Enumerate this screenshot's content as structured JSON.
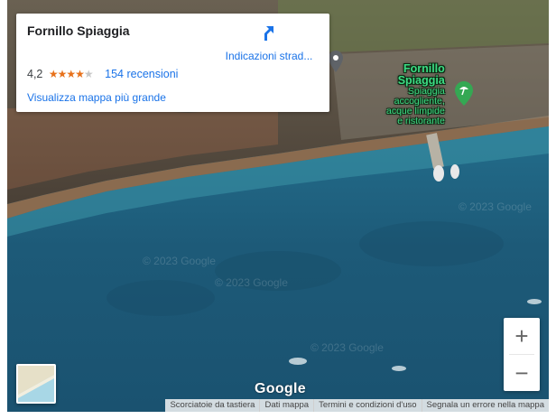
{
  "place": {
    "name": "Fornillo Spiaggia",
    "rating_text": "4,2",
    "rating": 4.2,
    "rating_max": 5,
    "stars_on": "★★★★",
    "stars_off": "★",
    "reviews_label": "154 recensioni",
    "bigger_map_label": "Visualizza mappa più grande",
    "directions_label": "Indicazioni strad..."
  },
  "poi": {
    "title_line1": "Fornillo",
    "title_line2": "Spiaggia",
    "desc_line1": "Spiaggia",
    "desc_line2": "accogliente,",
    "desc_line3": "acque limpide",
    "desc_line4": "e ristorante",
    "icon": "beach-umbrella-pin-icon"
  },
  "controls": {
    "zoom_in": "+",
    "zoom_out": "−"
  },
  "branding": {
    "logo": "Google",
    "watermark": "© 2023 Google"
  },
  "footer": {
    "shortcuts": "Scorciatoie da tastiera",
    "map_data": "Dati mappa",
    "terms": "Termini e condizioni d'uso",
    "report": "Segnala un errore nella mappa"
  },
  "colors": {
    "link": "#1a73e8",
    "star": "#e7711b",
    "poi_label": "#3ddc84",
    "sea_deep": "#1d5a78",
    "sea_shallow": "#2f8aa3",
    "sand": "#8a6b4f"
  }
}
